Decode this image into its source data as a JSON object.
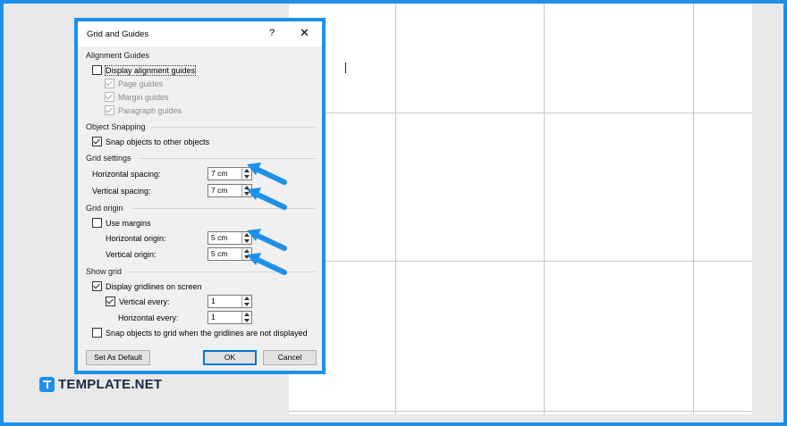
{
  "dialog": {
    "title": "Grid and Guides",
    "help": "?",
    "close": "✕",
    "sections": {
      "alignment": "Alignment Guides",
      "snapping": "Object Snapping",
      "grid_settings": "Grid settings",
      "grid_origin": "Grid origin",
      "show_grid": "Show grid"
    },
    "alignment": {
      "display_alignment_guides": "Display alignment guides",
      "page_guides": "Page guides",
      "margin_guides": "Margin guides",
      "paragraph_guides": "Paragraph guides"
    },
    "snapping": {
      "snap_to_objects": "Snap objects to other objects"
    },
    "grid_settings": {
      "horizontal_spacing_label": "Horizontal spacing:",
      "horizontal_spacing_value": "7 cm",
      "vertical_spacing_label": "Vertical spacing:",
      "vertical_spacing_value": "7 cm"
    },
    "grid_origin": {
      "use_margins": "Use margins",
      "horizontal_origin_label": "Horizontal origin:",
      "horizontal_origin_value": "5 cm",
      "vertical_origin_label": "Vertical origin:",
      "vertical_origin_value": "5 cm"
    },
    "show_grid": {
      "display_gridlines": "Display gridlines on screen",
      "vertical_every_label": "Vertical every:",
      "vertical_every_value": "1",
      "horizontal_every_label": "Horizontal every:",
      "horizontal_every_value": "1",
      "snap_when_hidden": "Snap objects to grid when the gridlines are not displayed"
    },
    "buttons": {
      "set_default": "Set As Default",
      "ok": "OK",
      "cancel": "Cancel"
    }
  },
  "brand": {
    "name": "TEMPLATE.NET"
  },
  "colors": {
    "accent": "#1e90e8",
    "brand_text": "#1a2a44"
  },
  "icons": [
    "pointing-arrow-icon",
    "spin-up-icon",
    "spin-down-icon",
    "checkmark-icon",
    "template-logo-icon"
  ]
}
